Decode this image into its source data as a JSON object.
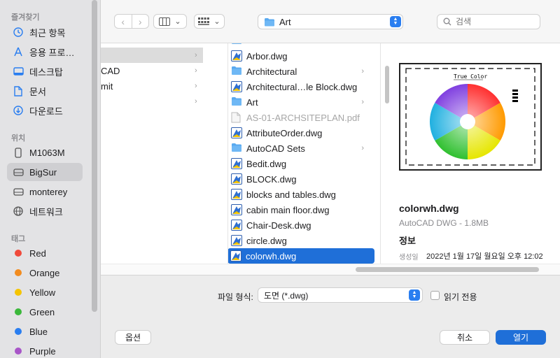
{
  "sidebar": {
    "favorites_title": "즐겨찾기",
    "favorites": [
      {
        "label": "최근 항목",
        "icon": "clock-icon"
      },
      {
        "label": "응용 프로…",
        "icon": "applications-icon"
      },
      {
        "label": "데스크탑",
        "icon": "desktop-icon"
      },
      {
        "label": "문서",
        "icon": "document-icon"
      },
      {
        "label": "다운로드",
        "icon": "download-icon"
      }
    ],
    "locations_title": "위치",
    "locations": [
      {
        "label": "M1063M",
        "icon": "disk-icon"
      },
      {
        "label": "BigSur",
        "icon": "drive-icon",
        "selected": true
      },
      {
        "label": "monterey",
        "icon": "drive-icon"
      },
      {
        "label": "네트워크",
        "icon": "network-icon"
      }
    ],
    "tags_title": "태그",
    "tags": [
      {
        "label": "Red",
        "color": "#f04a3b"
      },
      {
        "label": "Orange",
        "color": "#f28c1f"
      },
      {
        "label": "Yellow",
        "color": "#f5c400"
      },
      {
        "label": "Green",
        "color": "#3bb83b"
      },
      {
        "label": "Blue",
        "color": "#2a7ef0"
      },
      {
        "label": "Purple",
        "color": "#a855c8"
      }
    ]
  },
  "toolbar": {
    "path_label": "Art",
    "search_placeholder": "검색"
  },
  "column1": {
    "items": [
      "CAD",
      "mit"
    ]
  },
  "column2": {
    "items": [
      {
        "label": "Arbor.dwg",
        "type": "dwg"
      },
      {
        "label": "Architectural",
        "type": "folder"
      },
      {
        "label": "Architectural…le Block.dwg",
        "type": "dwg"
      },
      {
        "label": "Art",
        "type": "folder"
      },
      {
        "label": "AS-01-ARCHSITEPLAN.pdf",
        "type": "pdf",
        "disabled": true
      },
      {
        "label": "AttributeOrder.dwg",
        "type": "dwg"
      },
      {
        "label": "AutoCAD Sets",
        "type": "folder"
      },
      {
        "label": "Bedit.dwg",
        "type": "dwg"
      },
      {
        "label": "BLOCK.dwg",
        "type": "dwg"
      },
      {
        "label": "blocks and tables.dwg",
        "type": "dwg"
      },
      {
        "label": "cabin main floor.dwg",
        "type": "dwg"
      },
      {
        "label": "Chair-Desk.dwg",
        "type": "dwg"
      },
      {
        "label": "circle.dwg",
        "type": "dwg"
      },
      {
        "label": "colorwh.dwg",
        "type": "dwg",
        "selected": true
      }
    ]
  },
  "preview": {
    "thumb_title": "True Color",
    "name": "colorwh.dwg",
    "kind": "AutoCAD DWG - 1.8MB",
    "info_title": "정보",
    "created_label": "생성일",
    "created_value": "2022년 1월 17일 월요일 오후 12:02"
  },
  "bottom": {
    "format_label": "파일 형식:",
    "format_value": "도면 (*.dwg)",
    "readonly_label": "읽기 전용",
    "options_label": "옵션",
    "cancel_label": "취소",
    "open_label": "열기"
  }
}
